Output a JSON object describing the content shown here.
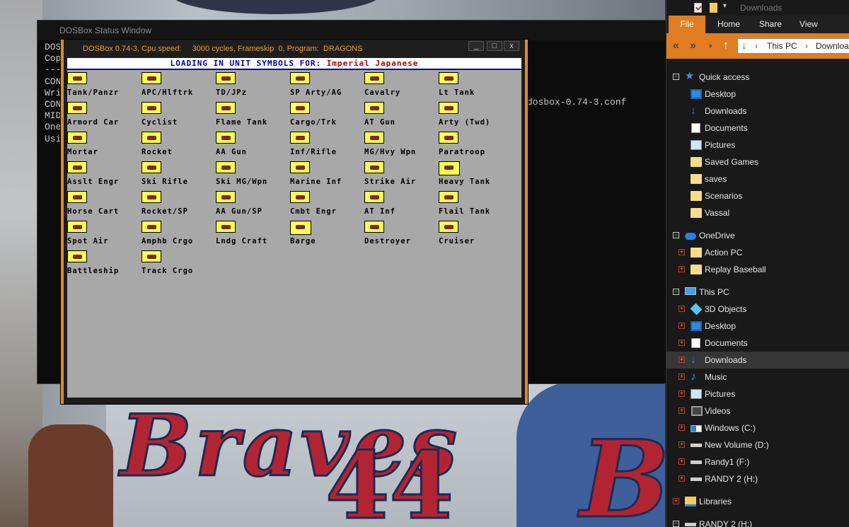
{
  "desktop": {
    "wallpaper_script": "Braves",
    "wallpaper_number": "44",
    "wallpaper_b": "B"
  },
  "status_window": {
    "title": "DOSBox Status Window",
    "console_lines": [
      "DOS",
      "Cop",
      "---",
      "CON",
      "Wri",
      "CON",
      "MID",
      "One",
      "Usi"
    ],
    "conf_text": "dosbox-0.74-3.conf"
  },
  "dosbox_window": {
    "title": "DOSBox 0.74-3, Cpu speed:     3000 cycles, Frameskip  0, Program:  DRAGONS",
    "min_glyph": "_",
    "max_glyph": "□",
    "close_glyph": "x",
    "loading_label": "LOADING IN UNIT SYMBOLS FOR:",
    "loading_faction": "Imperial Japanese",
    "units": [
      "Tank/Panzr",
      "APC/Hlftrk",
      "TD/JPz",
      "SP Arty/AG",
      "Cavalry",
      "Lt Tank",
      "Armord Car",
      "Cyclist",
      "Flame Tank",
      "Cargo/Trk",
      "AT Gun",
      "Arty (Twd)",
      "Mortar",
      "Rocket",
      "AA Gun",
      "Inf/Rifle",
      "MG/Hvy Wpn",
      "Paratroop",
      "Asslt Engr",
      "Ski Rifle",
      "Ski MG/Wpn",
      "Marine Inf",
      "Strike Air",
      "Heavy Tank",
      "Horse Cart",
      "Rocket/SP",
      "AA Gun/SP",
      "Cmbt Engr",
      "AT Inf",
      "Flail Tank",
      "Spot Air",
      "Amphb Crgo",
      "Lndg Craft",
      "Barge",
      "Destroyer",
      "Cruiser",
      "Battleship",
      "Track Crgo"
    ]
  },
  "explorer": {
    "qat_title": "Downloads",
    "qat_dropdown": "▾",
    "tabs": {
      "file": "File",
      "home": "Home",
      "share": "Share",
      "view": "View"
    },
    "address": {
      "this_pc": "This PC",
      "downloads": "Downloads",
      "sep": "›"
    },
    "nav_glyphs": {
      "back": "«",
      "forward": "»",
      "dropdown": "▾",
      "up": "↑",
      "download": "↓"
    },
    "tree": {
      "quick_access": "Quick access",
      "qa_desktop": "Desktop",
      "qa_downloads": "Downloads",
      "qa_documents": "Documents",
      "qa_pictures": "Pictures",
      "qa_saved_games": "Saved Games",
      "qa_saves": "saves",
      "qa_scenarios": "Scenarios",
      "qa_vassal": "Vassal",
      "onedrive": "OneDrive",
      "od_action_pc": "Action PC",
      "od_replay_baseball": "Replay Baseball",
      "this_pc": "This PC",
      "pc_3d_objects": "3D Objects",
      "pc_desktop": "Desktop",
      "pc_documents": "Documents",
      "pc_downloads": "Downloads",
      "pc_music": "Music",
      "pc_pictures": "Pictures",
      "pc_videos": "Videos",
      "pc_windows_c": "Windows (C:)",
      "pc_new_volume_d": "New Volume (D:)",
      "pc_randy1_f": "Randy1 (F:)",
      "pc_randy2_h": "RANDY 2 (H:)",
      "libraries": "Libraries",
      "randy2_h_bottom": "RANDY 2 (H:)"
    },
    "colors": {
      "accent": "#e07d22",
      "selected": "#363636"
    }
  }
}
